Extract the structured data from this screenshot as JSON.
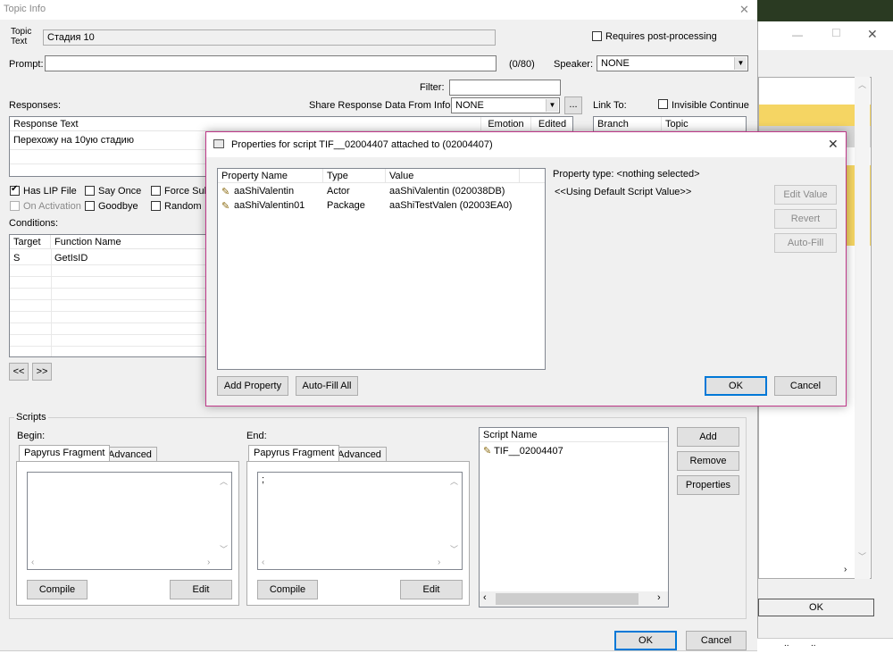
{
  "main": {
    "title": "Topic Info",
    "topic_text_label": "Topic\nText",
    "topic_text_value": "Стадия 10",
    "requires_post_processing_label": "Requires post-processing",
    "prompt_label": "Prompt:",
    "prompt_value": "",
    "prompt_count": "(0/80)",
    "speaker_label": "Speaker:",
    "speaker_value": "NONE",
    "filter_label": "Filter:",
    "filter_value": "",
    "responses_label": "Responses:",
    "share_label": "Share Response Data From Info:",
    "share_value": "NONE",
    "ellipsis_label": "...",
    "link_to_label": "Link To:",
    "invisible_continue_label": "Invisible Continue",
    "responses_table": {
      "headers": [
        "Response Text",
        "Emotion",
        "Edited"
      ],
      "rows": [
        [
          "Перехожу на 10ую стадию",
          "",
          ""
        ]
      ]
    },
    "link_table": {
      "headers": [
        "Branch",
        "Topic"
      ]
    },
    "has_lip_label": "Has LIP File",
    "say_once_label": "Say Once",
    "force_sub_label": "Force Sub",
    "on_activation_label": "On Activation",
    "goodbye_label": "Goodbye",
    "random_label": "Random",
    "conditions_label": "Conditions:",
    "conditions_table": {
      "headers": [
        "Target",
        "Function Name"
      ],
      "rows": [
        [
          "S",
          "GetIsID"
        ]
      ]
    },
    "prev_label": "<<",
    "next_label": ">>",
    "scripts_group_label": "Scripts",
    "begin_label": "Begin:",
    "end_label": "End:",
    "tab_papyrus": "Papyrus Fragment",
    "tab_advanced": "Advanced",
    "begin_text": "",
    "end_text": ";",
    "compile_label": "Compile",
    "edit_label": "Edit",
    "script_name_header": "Script Name",
    "script_row": "TIF__02004407",
    "add_label": "Add",
    "remove_label": "Remove",
    "properties_label": "Properties",
    "ok_label": "OK",
    "cancel_label": "Cancel"
  },
  "props": {
    "title": "Properties for script TIF__02004407 attached to  (02004407)",
    "headers": [
      "Property Name",
      "Type",
      "Value"
    ],
    "rows": [
      {
        "name": "aaShiValentin",
        "type": "Actor",
        "value": "aaShiValentin (020038DB)"
      },
      {
        "name": "aaShiValentin01",
        "type": "Package",
        "value": "aaShiTestValen (02003EA0)"
      }
    ],
    "property_type_label": "Property type: <nothing selected>",
    "default_value_label": "<<Using Default Script Value>>",
    "edit_value_label": "Edit Value",
    "revert_label": "Revert",
    "auto_fill_label": "Auto-Fill",
    "add_property_label": "Add Property",
    "auto_fill_all_label": "Auto-Fill All",
    "ok_label": "OK",
    "cancel_label": "Cancel"
  },
  "back": {
    "ok_label": "OK",
    "grid_cells": [
      "..",
      ".."
    ]
  },
  "colors": {
    "accent_border": "#c0398a",
    "yellow_band": "#f5d563",
    "desktop": "#2a3a22"
  }
}
